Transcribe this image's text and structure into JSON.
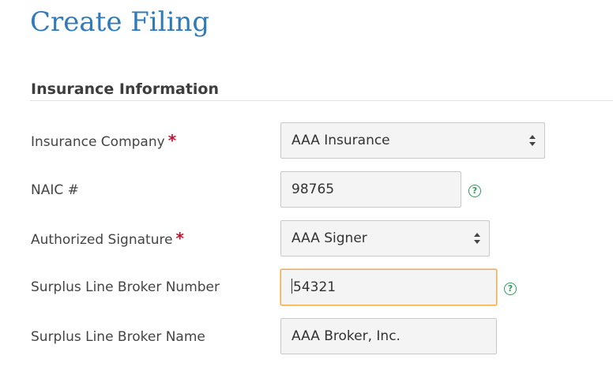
{
  "page": {
    "title": "Create Filing"
  },
  "section": {
    "title": "Insurance Information"
  },
  "fields": {
    "insurance_company": {
      "label": "Insurance Company",
      "required_mark": "*",
      "value": "AAA Insurance"
    },
    "naic": {
      "label": "NAIC #",
      "value": "98765",
      "help": "?"
    },
    "authorized_signature": {
      "label": "Authorized Signature",
      "required_mark": "*",
      "value": "AAA Signer"
    },
    "broker_number": {
      "label": "Surplus Line Broker Number",
      "value": "54321",
      "help": "?"
    },
    "broker_name": {
      "label": "Surplus Line Broker Name",
      "value": "AAA Broker, Inc."
    }
  },
  "colors": {
    "title": "#2f7ab9",
    "required": "#c8102e",
    "help_icon": "#2e9d5a",
    "focus_border": "#f0ad4e"
  }
}
